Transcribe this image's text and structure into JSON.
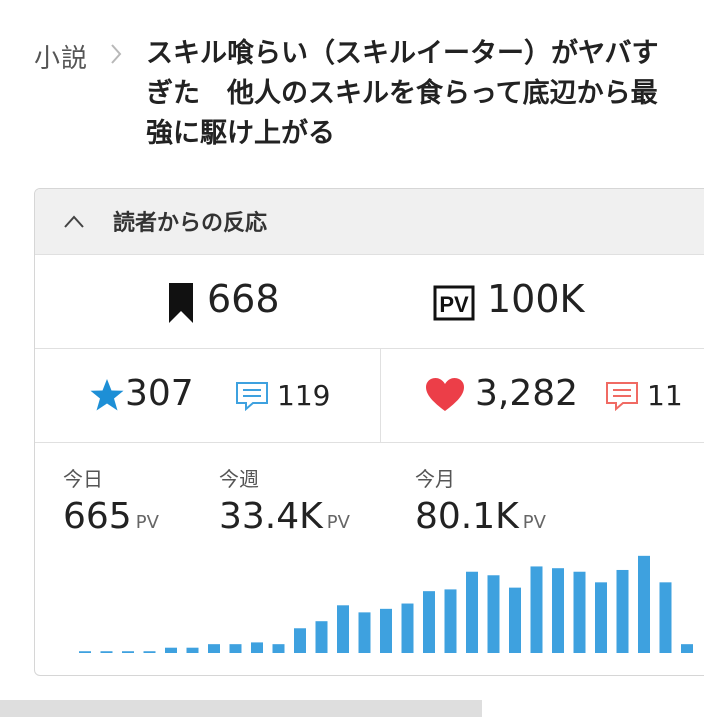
{
  "breadcrumb": {
    "parent": "小説",
    "title": "スキル喰らい（スキルイーター）がヤバすぎた　他人のスキルを食らって底辺から最強に駆け上がる"
  },
  "panel": {
    "header_title": "読者からの反応",
    "bookmarks": "668",
    "pv_total": "100K",
    "stars": "307",
    "reviews": "119",
    "likes": "3,282",
    "impressions": "11",
    "stats": {
      "today": {
        "label": "今日",
        "value": "665",
        "unit": "PV"
      },
      "week": {
        "label": "今週",
        "value": "33.4K",
        "unit": "PV"
      },
      "month": {
        "label": "今月",
        "value": "80.1K",
        "unit": "PV"
      }
    }
  },
  "colors": {
    "accent_blue": "#3ea1df",
    "star_blue": "#1d8fd6",
    "heart_red": "#ec3e48",
    "impression_red": "#f06a63"
  },
  "icons": [
    "chevron-up-icon",
    "bookmark-icon",
    "pv-icon",
    "star-icon",
    "review-icon",
    "heart-icon",
    "impression-icon"
  ],
  "chart_data": {
    "type": "bar",
    "values": [
      1,
      1,
      1,
      1,
      3,
      3,
      5,
      5,
      6,
      5,
      14,
      18,
      27,
      23,
      25,
      28,
      35,
      36,
      46,
      44,
      37,
      49,
      48,
      46,
      40,
      47,
      55,
      40,
      5
    ],
    "ylim": [
      0,
      60
    ]
  }
}
